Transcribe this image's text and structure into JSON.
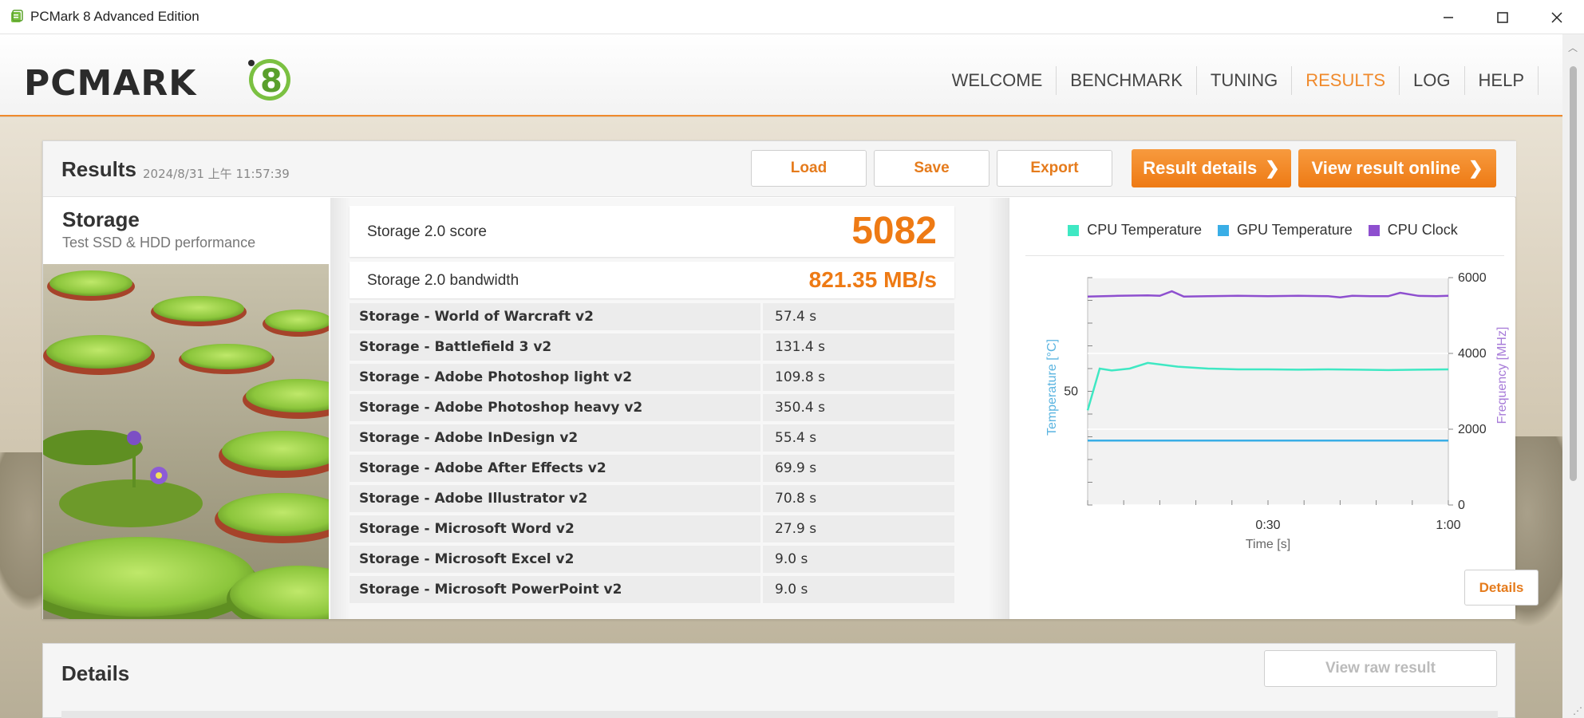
{
  "window": {
    "title": "PCMark 8 Advanced Edition",
    "minimize": "—",
    "maximize": "☐",
    "close": "✕"
  },
  "nav": {
    "items": [
      {
        "label": "WELCOME",
        "active": false
      },
      {
        "label": "BENCHMARK",
        "active": false
      },
      {
        "label": "TUNING",
        "active": false
      },
      {
        "label": "RESULTS",
        "active": true
      },
      {
        "label": "LOG",
        "active": false
      },
      {
        "label": "HELP",
        "active": false
      }
    ]
  },
  "results": {
    "title": "Results",
    "date": "2024/8/31 上午 11:57:39",
    "buttons": {
      "load": "Load",
      "save": "Save",
      "export": "Export",
      "result_details": "Result details",
      "view_online": "View result online",
      "chevron": "❯"
    }
  },
  "benchmark": {
    "name": "Storage",
    "description": "Test SSD & HDD performance"
  },
  "scores": {
    "score_label": "Storage 2.0 score",
    "score_value": "5082",
    "bandwidth_label": "Storage 2.0 bandwidth",
    "bandwidth_value": "821.35 MB/s"
  },
  "tests": [
    {
      "name": "Storage - World of Warcraft v2",
      "value": "57.4 s"
    },
    {
      "name": "Storage - Battlefield 3 v2",
      "value": "131.4 s"
    },
    {
      "name": "Storage - Adobe Photoshop light v2",
      "value": "109.8 s"
    },
    {
      "name": "Storage - Adobe Photoshop heavy v2",
      "value": "350.4 s"
    },
    {
      "name": "Storage - Adobe InDesign v2",
      "value": "55.4 s"
    },
    {
      "name": "Storage - Adobe After Effects v2",
      "value": "69.9 s"
    },
    {
      "name": "Storage - Adobe Illustrator v2",
      "value": "70.8 s"
    },
    {
      "name": "Storage - Microsoft Word v2",
      "value": "27.9 s"
    },
    {
      "name": "Storage - Microsoft Excel v2",
      "value": "9.0 s"
    },
    {
      "name": "Storage - Microsoft PowerPoint v2",
      "value": "9.0 s"
    }
  ],
  "monitoring": {
    "details_button": "Details"
  },
  "details": {
    "title": "Details",
    "raw_button": "View raw result"
  },
  "colors": {
    "accent": "#ee7a14",
    "cpu_temp": "#3fe8c3",
    "gpu_temp": "#3aaee6",
    "cpu_clock": "#8e4fcf"
  },
  "chart_data": {
    "type": "line",
    "legend": [
      "CPU Temperature",
      "GPU Temperature",
      "CPU Clock"
    ],
    "xlabel": "Time [s]",
    "ylabel_left": "Temperature [°C]",
    "ylabel_right": "Frequency [MHz]",
    "x_ticks": [
      "0:30",
      "1:00"
    ],
    "x_tick_values": [
      30,
      60
    ],
    "xlim": [
      0,
      60
    ],
    "left_ticks": [
      "50"
    ],
    "left_tick_values": [
      50
    ],
    "ylim_left": [
      20,
      80
    ],
    "right_ticks": [
      "6000",
      "4000",
      "2000",
      "0"
    ],
    "right_tick_values": [
      6000,
      4000,
      2000,
      0
    ],
    "ylim_right": [
      0,
      6000
    ],
    "series": [
      {
        "name": "CPU Temperature",
        "axis": "left",
        "x": [
          0,
          2,
          4,
          7,
          10,
          15,
          20,
          25,
          30,
          35,
          40,
          45,
          50,
          55,
          60
        ],
        "y": [
          45,
          56,
          55.5,
          56,
          57.5,
          56.5,
          56,
          55.8,
          55.8,
          55.7,
          55.8,
          55.7,
          55.6,
          55.7,
          55.8
        ]
      },
      {
        "name": "GPU Temperature",
        "axis": "left",
        "x": [
          0,
          60
        ],
        "y": [
          37,
          37
        ]
      },
      {
        "name": "CPU Clock",
        "axis": "right",
        "x": [
          0,
          5,
          10,
          12,
          14,
          16,
          20,
          25,
          30,
          35,
          40,
          42,
          44,
          47,
          50,
          52,
          55,
          58,
          60
        ],
        "y": [
          5500,
          5520,
          5530,
          5520,
          5640,
          5500,
          5510,
          5520,
          5510,
          5520,
          5510,
          5480,
          5520,
          5510,
          5510,
          5600,
          5520,
          5510,
          5520
        ]
      }
    ]
  }
}
